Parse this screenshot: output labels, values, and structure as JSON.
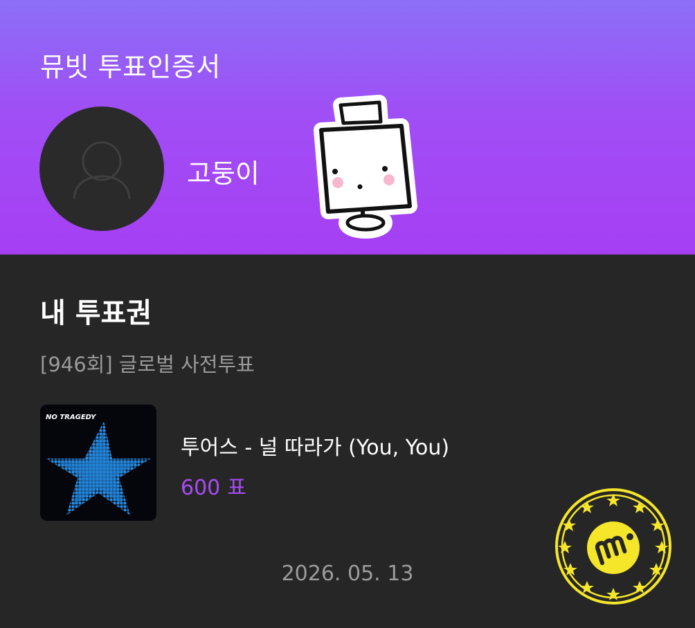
{
  "header": {
    "title": "뮤빗 투표인증서",
    "username": "고둥이",
    "avatar_icon": "user-silhouette-icon",
    "sticker": "cute-character-sticker"
  },
  "ticket": {
    "section_title": "내 투표권",
    "round_label": "[946회] 글로벌 사전투표",
    "album_cover_text": "NO TRAGEDY",
    "song": "투어스 - 널 따라가 (You, You)",
    "votes_value": "600",
    "votes_unit": "표",
    "date": "2026. 05. 13"
  },
  "colors": {
    "header_top": "#8b6ff7",
    "header_bottom": "#a63ff4",
    "background": "#262626",
    "accent": "#a94cf3",
    "stamp": "#f5e62a"
  },
  "stamp": {
    "icon": "mubeat-stamp-icon"
  }
}
